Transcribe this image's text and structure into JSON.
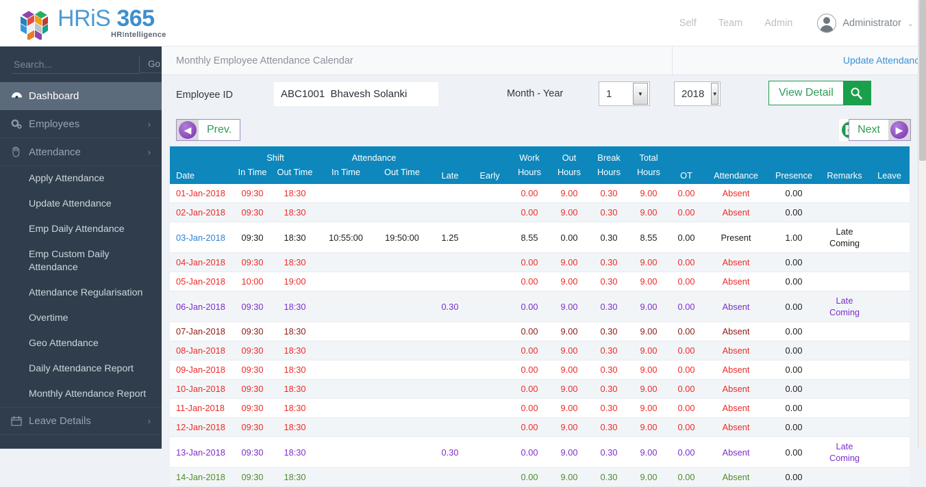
{
  "brand": {
    "name_prefix": "HR",
    "name_i": "i",
    "name_s": "S",
    "name_number": "365",
    "tagline_left": "HR",
    "tagline_bar": "I",
    "tagline_right": "ntelligence"
  },
  "topnav": {
    "items": [
      {
        "label": "Self"
      },
      {
        "label": "Team"
      },
      {
        "label": "Admin"
      }
    ],
    "user": "Administrator",
    "chevron": "⌄"
  },
  "sidebar": {
    "search_placeholder": "Search...",
    "search_value": "",
    "go_label": "Go",
    "items": [
      {
        "label": "Dashboard",
        "icon": "dashboard-icon",
        "glyph": "◉",
        "active": true,
        "chevron": ""
      },
      {
        "label": "Employees",
        "icon": "gears-icon",
        "glyph": "✿",
        "active": false,
        "chevron": "›"
      },
      {
        "label": "Attendance",
        "icon": "hand-icon",
        "glyph": "✋",
        "active": false,
        "chevron": "›"
      }
    ],
    "sub_items": [
      {
        "label": "Apply Attendance"
      },
      {
        "label": "Update Attendance"
      },
      {
        "label": "Emp Daily Attendance"
      },
      {
        "label": "Emp Custom Daily Attendance"
      },
      {
        "label": "Attendance Regularisation"
      },
      {
        "label": "Overtime"
      },
      {
        "label": "Geo Attendance"
      },
      {
        "label": "Daily Attendance Report"
      },
      {
        "label": "Monthly Attendance Report"
      }
    ],
    "bottom_item": {
      "label": "Leave Details",
      "icon": "calendar-icon",
      "glyph": "▦",
      "chevron": "›"
    }
  },
  "panel": {
    "title": "Monthly Employee Attendance Calendar",
    "update_link": "Update Attendance"
  },
  "filters": {
    "employee_label": "Employee ID",
    "employee_value": "ABC1001  Bhavesh Solanki",
    "employee_placeholder": "Employee ID",
    "month_year_label": "Month - Year",
    "month_value": "1",
    "year_value": "2018",
    "view_detail_label": "View Detail"
  },
  "pager": {
    "prev_label": "Prev.",
    "next_label": "Next",
    "prev_arrow": "◀",
    "next_arrow": "▶",
    "excel_label": "x"
  },
  "table": {
    "group_headers": {
      "date": "Date",
      "shift": "Shift",
      "attendance": "Attendance",
      "late": "Late",
      "early": "Early",
      "work_hours_1": "Work",
      "out_hours_1": "Out",
      "break_hours_1": "Break",
      "total_hours_1": "Total",
      "ot": "OT",
      "attendance_status": "Attendance",
      "presence": "Presence",
      "remarks": "Remarks",
      "leave": "Leave"
    },
    "sub_headers": {
      "shift_in": "In Time",
      "shift_out": "Out Time",
      "att_in": "In Time",
      "att_out": "Out Time",
      "work_hours_2": "Hours",
      "out_hours_2": "Hours",
      "break_hours_2": "Hours",
      "total_hours_2": "Hours"
    },
    "row_colors": {
      "absent": "#ee2a26",
      "present": "#1b1b1b",
      "weekoff": "#7c2ecb",
      "holiday": "#4f8c2a",
      "dark": "#8b1a13",
      "date_link": "#2f7fd0"
    },
    "rows": [
      {
        "date": "01-Jan-2018",
        "shift_in": "09:30",
        "shift_out": "18:30",
        "att_in": "",
        "att_out": "",
        "late": "",
        "early": "",
        "work_hours": "0.00",
        "out_hours": "9.00",
        "break_hours": "0.30",
        "total_hours": "9.00",
        "ot": "0.00",
        "attendance": "Absent",
        "presence": "0.00",
        "remarks": "",
        "leave": "",
        "color": "absent"
      },
      {
        "date": "02-Jan-2018",
        "shift_in": "09:30",
        "shift_out": "18:30",
        "att_in": "",
        "att_out": "",
        "late": "",
        "early": "",
        "work_hours": "0.00",
        "out_hours": "9.00",
        "break_hours": "0.30",
        "total_hours": "9.00",
        "ot": "0.00",
        "attendance": "Absent",
        "presence": "0.00",
        "remarks": "",
        "leave": "",
        "color": "absent"
      },
      {
        "date": "03-Jan-2018",
        "shift_in": "09:30",
        "shift_out": "18:30",
        "att_in": "10:55:00",
        "att_out": "19:50:00",
        "late": "1.25",
        "early": "",
        "work_hours": "8.55",
        "out_hours": "0.00",
        "break_hours": "0.30",
        "total_hours": "8.55",
        "ot": "0.00",
        "attendance": "Present",
        "presence": "1.00",
        "remarks": "Late Coming",
        "leave": "",
        "color": "present",
        "date_link": true
      },
      {
        "date": "04-Jan-2018",
        "shift_in": "09:30",
        "shift_out": "18:30",
        "att_in": "",
        "att_out": "",
        "late": "",
        "early": "",
        "work_hours": "0.00",
        "out_hours": "9.00",
        "break_hours": "0.30",
        "total_hours": "9.00",
        "ot": "0.00",
        "attendance": "Absent",
        "presence": "0.00",
        "remarks": "",
        "leave": "",
        "color": "absent"
      },
      {
        "date": "05-Jan-2018",
        "shift_in": "10:00",
        "shift_out": "19:00",
        "att_in": "",
        "att_out": "",
        "late": "",
        "early": "",
        "work_hours": "0.00",
        "out_hours": "9.00",
        "break_hours": "0.30",
        "total_hours": "9.00",
        "ot": "0.00",
        "attendance": "Absent",
        "presence": "0.00",
        "remarks": "",
        "leave": "",
        "color": "absent"
      },
      {
        "date": "06-Jan-2018",
        "shift_in": "09:30",
        "shift_out": "18:30",
        "att_in": "",
        "att_out": "",
        "late": "0.30",
        "early": "",
        "work_hours": "0.00",
        "out_hours": "9.00",
        "break_hours": "0.30",
        "total_hours": "9.00",
        "ot": "0.00",
        "attendance": "Absent",
        "presence": "0.00",
        "remarks": "Late Coming",
        "leave": "",
        "color": "weekoff"
      },
      {
        "date": "07-Jan-2018",
        "shift_in": "09:30",
        "shift_out": "18:30",
        "att_in": "",
        "att_out": "",
        "late": "",
        "early": "",
        "work_hours": "0.00",
        "out_hours": "9.00",
        "break_hours": "0.30",
        "total_hours": "9.00",
        "ot": "0.00",
        "attendance": "Absent",
        "presence": "0.00",
        "remarks": "",
        "leave": "",
        "color": "dark"
      },
      {
        "date": "08-Jan-2018",
        "shift_in": "09:30",
        "shift_out": "18:30",
        "att_in": "",
        "att_out": "",
        "late": "",
        "early": "",
        "work_hours": "0.00",
        "out_hours": "9.00",
        "break_hours": "0.30",
        "total_hours": "9.00",
        "ot": "0.00",
        "attendance": "Absent",
        "presence": "0.00",
        "remarks": "",
        "leave": "",
        "color": "absent"
      },
      {
        "date": "09-Jan-2018",
        "shift_in": "09:30",
        "shift_out": "18:30",
        "att_in": "",
        "att_out": "",
        "late": "",
        "early": "",
        "work_hours": "0.00",
        "out_hours": "9.00",
        "break_hours": "0.30",
        "total_hours": "9.00",
        "ot": "0.00",
        "attendance": "Absent",
        "presence": "0.00",
        "remarks": "",
        "leave": "",
        "color": "absent"
      },
      {
        "date": "10-Jan-2018",
        "shift_in": "09:30",
        "shift_out": "18:30",
        "att_in": "",
        "att_out": "",
        "late": "",
        "early": "",
        "work_hours": "0.00",
        "out_hours": "9.00",
        "break_hours": "0.30",
        "total_hours": "9.00",
        "ot": "0.00",
        "attendance": "Absent",
        "presence": "0.00",
        "remarks": "",
        "leave": "",
        "color": "absent"
      },
      {
        "date": "11-Jan-2018",
        "shift_in": "09:30",
        "shift_out": "18:30",
        "att_in": "",
        "att_out": "",
        "late": "",
        "early": "",
        "work_hours": "0.00",
        "out_hours": "9.00",
        "break_hours": "0.30",
        "total_hours": "9.00",
        "ot": "0.00",
        "attendance": "Absent",
        "presence": "0.00",
        "remarks": "",
        "leave": "",
        "color": "absent"
      },
      {
        "date": "12-Jan-2018",
        "shift_in": "09:30",
        "shift_out": "18:30",
        "att_in": "",
        "att_out": "",
        "late": "",
        "early": "",
        "work_hours": "0.00",
        "out_hours": "9.00",
        "break_hours": "0.30",
        "total_hours": "9.00",
        "ot": "0.00",
        "attendance": "Absent",
        "presence": "0.00",
        "remarks": "",
        "leave": "",
        "color": "absent"
      },
      {
        "date": "13-Jan-2018",
        "shift_in": "09:30",
        "shift_out": "18:30",
        "att_in": "",
        "att_out": "",
        "late": "0.30",
        "early": "",
        "work_hours": "0.00",
        "out_hours": "9.00",
        "break_hours": "0.30",
        "total_hours": "9.00",
        "ot": "0.00",
        "attendance": "Absent",
        "presence": "0.00",
        "remarks": "Late Coming",
        "leave": "",
        "color": "weekoff"
      },
      {
        "date": "14-Jan-2018",
        "shift_in": "09:30",
        "shift_out": "18:30",
        "att_in": "",
        "att_out": "",
        "late": "",
        "early": "",
        "work_hours": "0.00",
        "out_hours": "9.00",
        "break_hours": "0.30",
        "total_hours": "9.00",
        "ot": "0.00",
        "attendance": "Absent",
        "presence": "0.00",
        "remarks": "",
        "leave": "",
        "color": "holiday"
      }
    ]
  }
}
